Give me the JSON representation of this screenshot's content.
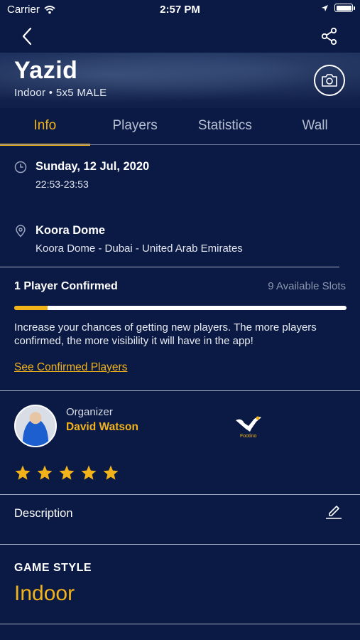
{
  "status_bar": {
    "carrier": "Carrier",
    "time": "2:57 PM"
  },
  "header": {
    "title": "Yazid",
    "subtitle": "Indoor • 5x5 MALE"
  },
  "tabs": [
    {
      "label": "Info",
      "active": true
    },
    {
      "label": "Players",
      "active": false
    },
    {
      "label": "Statistics",
      "active": false
    },
    {
      "label": "Wall",
      "active": false
    }
  ],
  "schedule": {
    "date": "Sunday, 12 Jul, 2020",
    "time_range": "22:53-23:53"
  },
  "location": {
    "venue": "Koora Dome",
    "address": "Koora Dome - Dubai - United Arab Emirates"
  },
  "players": {
    "confirmed": "1 Player Confirmed",
    "available": "9 Available Slots",
    "progress_fraction": 0.1,
    "info": "Increase your chances of getting new players. The more players confirmed, the more visibility it will have in the app!",
    "link": "See Confirmed Players"
  },
  "organizer": {
    "role": "Organizer",
    "name": "David Watson",
    "logo_text": "Footino",
    "rating": 5
  },
  "description": {
    "label": "Description"
  },
  "game_style": {
    "label": "GAME STYLE",
    "value": "Indoor"
  },
  "colors": {
    "background": "#0b1a44",
    "accent": "#f2b31a",
    "text": "#ffffff",
    "muted": "#8c95ae"
  },
  "icons": [
    "wifi-icon",
    "location-arrow-icon",
    "battery-icon",
    "back-icon",
    "share-icon",
    "camera-icon",
    "clock-icon",
    "pin-icon",
    "star-icon",
    "edit-icon"
  ]
}
